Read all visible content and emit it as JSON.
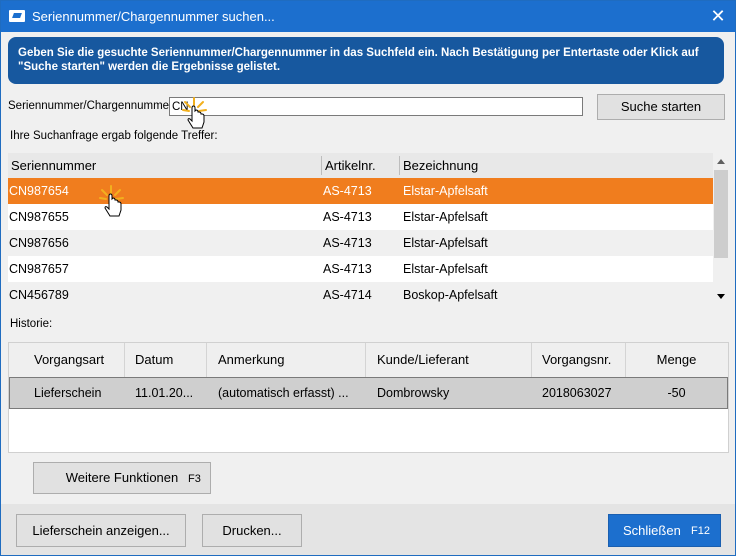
{
  "window": {
    "title": "Seriennummer/Chargennummer suchen...",
    "close_glyph": "✕"
  },
  "banner": {
    "text": "Geben Sie die gesuchte Seriennummer/Chargennummer in das Suchfeld ein. Nach Bestätigung per Entertaste oder Klick auf \"Suche starten\" werden die Ergebnisse gelistet."
  },
  "search": {
    "label": "Seriennummer/Chargennummer:",
    "value": "CN",
    "button_label": "Suche starten",
    "result_label": "Ihre Suchanfrage ergab folgende Treffer:"
  },
  "results": {
    "columns": [
      "Seriennummer",
      "Artikelnr.",
      "Bezeichnung"
    ],
    "rows": [
      {
        "serial": "CN987654",
        "article": "AS-4713",
        "name": "Elstar-Apfelsaft",
        "selected": true
      },
      {
        "serial": "CN987655",
        "article": "AS-4713",
        "name": "Elstar-Apfelsaft"
      },
      {
        "serial": "CN987656",
        "article": "AS-4713",
        "name": "Elstar-Apfelsaft"
      },
      {
        "serial": "CN987657",
        "article": "AS-4713",
        "name": "Elstar-Apfelsaft"
      },
      {
        "serial": "CN456789",
        "article": "AS-4714",
        "name": "Boskop-Apfelsaft"
      }
    ]
  },
  "history": {
    "label": "Historie:",
    "columns": [
      "Vorgangsart",
      "Datum",
      "Anmerkung",
      "Kunde/Lieferant",
      "Vorgangsnr.",
      "Menge"
    ],
    "rows": [
      {
        "type": "Lieferschein",
        "date": "11.01.20...",
        "note": "(automatisch erfasst) ...",
        "party": "Dombrowsky",
        "number": "2018063027",
        "quantity": "-50"
      }
    ]
  },
  "buttons": {
    "more_functions": "Weitere Funktionen",
    "more_functions_key": "F3",
    "show_delivery_note": "Lieferschein anzeigen...",
    "print": "Drucken...",
    "close": "Schließen",
    "close_key": "F12"
  },
  "colors": {
    "titlebar": "#1c6fce",
    "banner": "#17589f",
    "selected_row": "#f07d1e",
    "primary_button": "#1c6fce"
  }
}
